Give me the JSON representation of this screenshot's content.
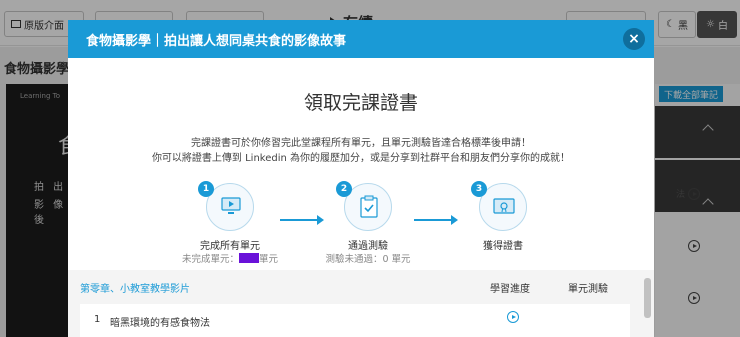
{
  "topbar": {
    "original_layout_label": "原版介面",
    "page_title": "有續",
    "theme_dark_label": "黑",
    "theme_light_label": "白"
  },
  "background": {
    "course_title": "食物攝影學",
    "video_caption_line1": "拍 出",
    "video_caption_line2": "影 像 後",
    "video_big_char": "食",
    "video_small_text": "Learning To",
    "notes_button": "下載全部筆記",
    "side_text": "法"
  },
  "modal": {
    "header_title": "食物攝影學｜拍出讓人想同桌共食的影像故事",
    "close_label": "×",
    "title": "領取完課證書",
    "description_line1": "完課證書可於你修習完此堂課程所有單元，且單元測驗皆達合格標準後申請！",
    "description_line2": "你可以將證書上傳到 Linkedin 為你的履歷加分，或是分享到社群平台和朋友們分享你的成就！",
    "steps": [
      {
        "number": "1",
        "label": "完成所有單元",
        "sub_prefix": "未完成單元：",
        "sub_suffix": "單元",
        "icon": "monitor-icon"
      },
      {
        "number": "2",
        "label": "通過測驗",
        "sub": "測驗未通過：0 單元",
        "icon": "clipboard-check-icon"
      },
      {
        "number": "3",
        "label": "獲得證書",
        "icon": "certificate-icon"
      }
    ],
    "table": {
      "chapter": "第零章、小教室教學影片",
      "col_progress": "學習進度",
      "col_quiz": "單元測驗",
      "rows": [
        {
          "number": "1",
          "name": "暗黑環境的有感食物法"
        }
      ]
    },
    "colors": {
      "accent": "#1a9ad6",
      "redaction": "#6a12d9"
    }
  }
}
